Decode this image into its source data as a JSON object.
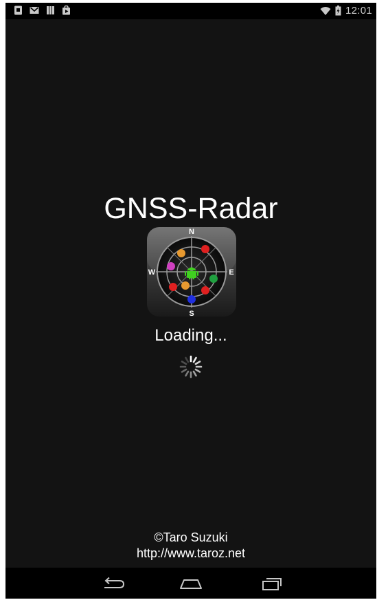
{
  "status_bar": {
    "time": "12:01",
    "left_icons": [
      "sim-card-icon",
      "gmail-icon",
      "signal-bars-icon",
      "play-store-icon"
    ],
    "right_icons": [
      "wifi-icon",
      "battery-icon"
    ]
  },
  "app": {
    "title": "GNSS-Radar",
    "loading_text": "Loading...",
    "credit_author": "©Taro Suzuki",
    "credit_url": "http://www.taroz.net",
    "compass_labels": {
      "north": "N",
      "east": "E",
      "south": "S",
      "west": "W"
    }
  },
  "navigation_bar": {
    "buttons": [
      "back-icon",
      "home-icon",
      "recent-apps-icon"
    ]
  },
  "colors": {
    "background": "#131313",
    "status_bar": "#000000",
    "text": "#ffffff",
    "satellite_red": "#e02020",
    "satellite_orange": "#e89a30",
    "satellite_magenta": "#d040c0",
    "satellite_green": "#20a040",
    "satellite_blue": "#2030e0",
    "receiver_green": "#40d020"
  }
}
